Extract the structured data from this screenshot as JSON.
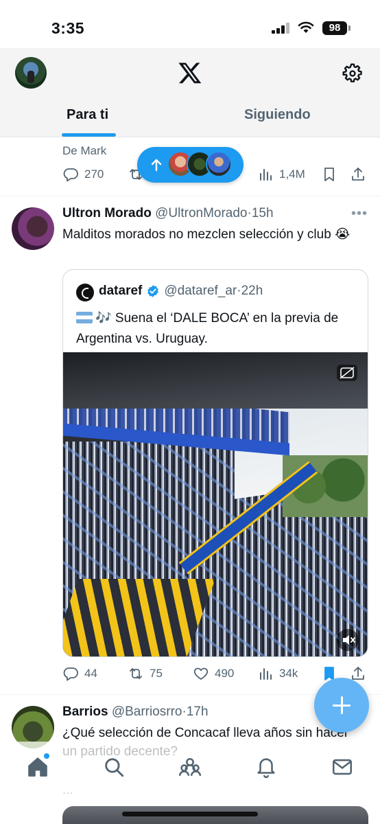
{
  "status_bar": {
    "time": "3:35",
    "battery": "98"
  },
  "header": {
    "tabs": [
      {
        "label": "Para ti",
        "active": true
      },
      {
        "label": "Siguiendo",
        "active": false
      }
    ]
  },
  "prev_tweet": {
    "author": "De Mark",
    "replies": "270",
    "views": "1,4M"
  },
  "new_posts_pill": {
    "avatars": 3
  },
  "tweet": {
    "name": "Ultron Morado",
    "handle": "@UltronMorado",
    "time": "15h",
    "text": "Malditos morados no mezclen selección y club 😭",
    "quote": {
      "name": "dataref",
      "handle": "@dataref_ar",
      "time": "22h",
      "text": "🎶 Suena el ‘DALE BOCA’ en la previa de Argentina vs. Uruguay."
    },
    "replies": "44",
    "reposts": "75",
    "likes": "490",
    "views": "34k"
  },
  "next_tweet": {
    "name": "Barrios",
    "handle": "@Barriosrro",
    "time": "17h",
    "text": "¿Qué selección de Concacaf lleva años sin hacer un partido decente?",
    "ellipsis": "..."
  },
  "colors": {
    "accent": "#1d9bf0",
    "fab": "#64b5f6",
    "text": "#0f1419",
    "muted": "#536471"
  },
  "icons": [
    "x-logo",
    "gear-icon",
    "reply-icon",
    "repost-icon",
    "like-icon",
    "views-icon",
    "bookmark-icon",
    "share-icon",
    "home-icon",
    "search-icon",
    "communities-icon",
    "bell-icon",
    "mail-icon",
    "plus-icon",
    "verified-icon"
  ]
}
